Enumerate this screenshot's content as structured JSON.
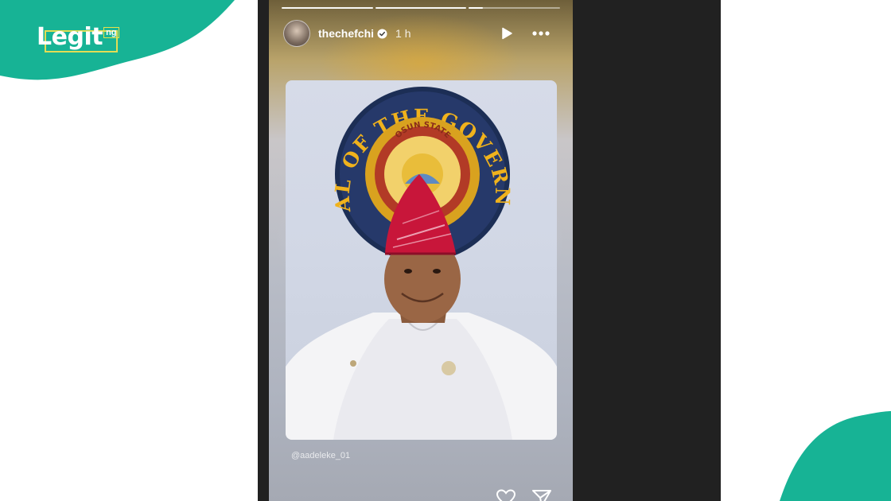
{
  "brand": {
    "logo_text": "Legit",
    "logo_suffix": "ng",
    "accent_color": "#17b395",
    "frame_color": "#e3dd54"
  },
  "story": {
    "progress": [
      1.0,
      1.0,
      0.15
    ],
    "username": "thechefchi",
    "verified": true,
    "time_ago": "1 h",
    "icons": [
      "play-icon",
      "more-icon"
    ],
    "photo": {
      "seal_text": "SEAL OF THE GOVERNOR",
      "seal_inner_text": "OSUN STATE"
    },
    "mention": "@aadeleke_01",
    "footer_icons": [
      "heart-icon",
      "send-icon"
    ]
  }
}
